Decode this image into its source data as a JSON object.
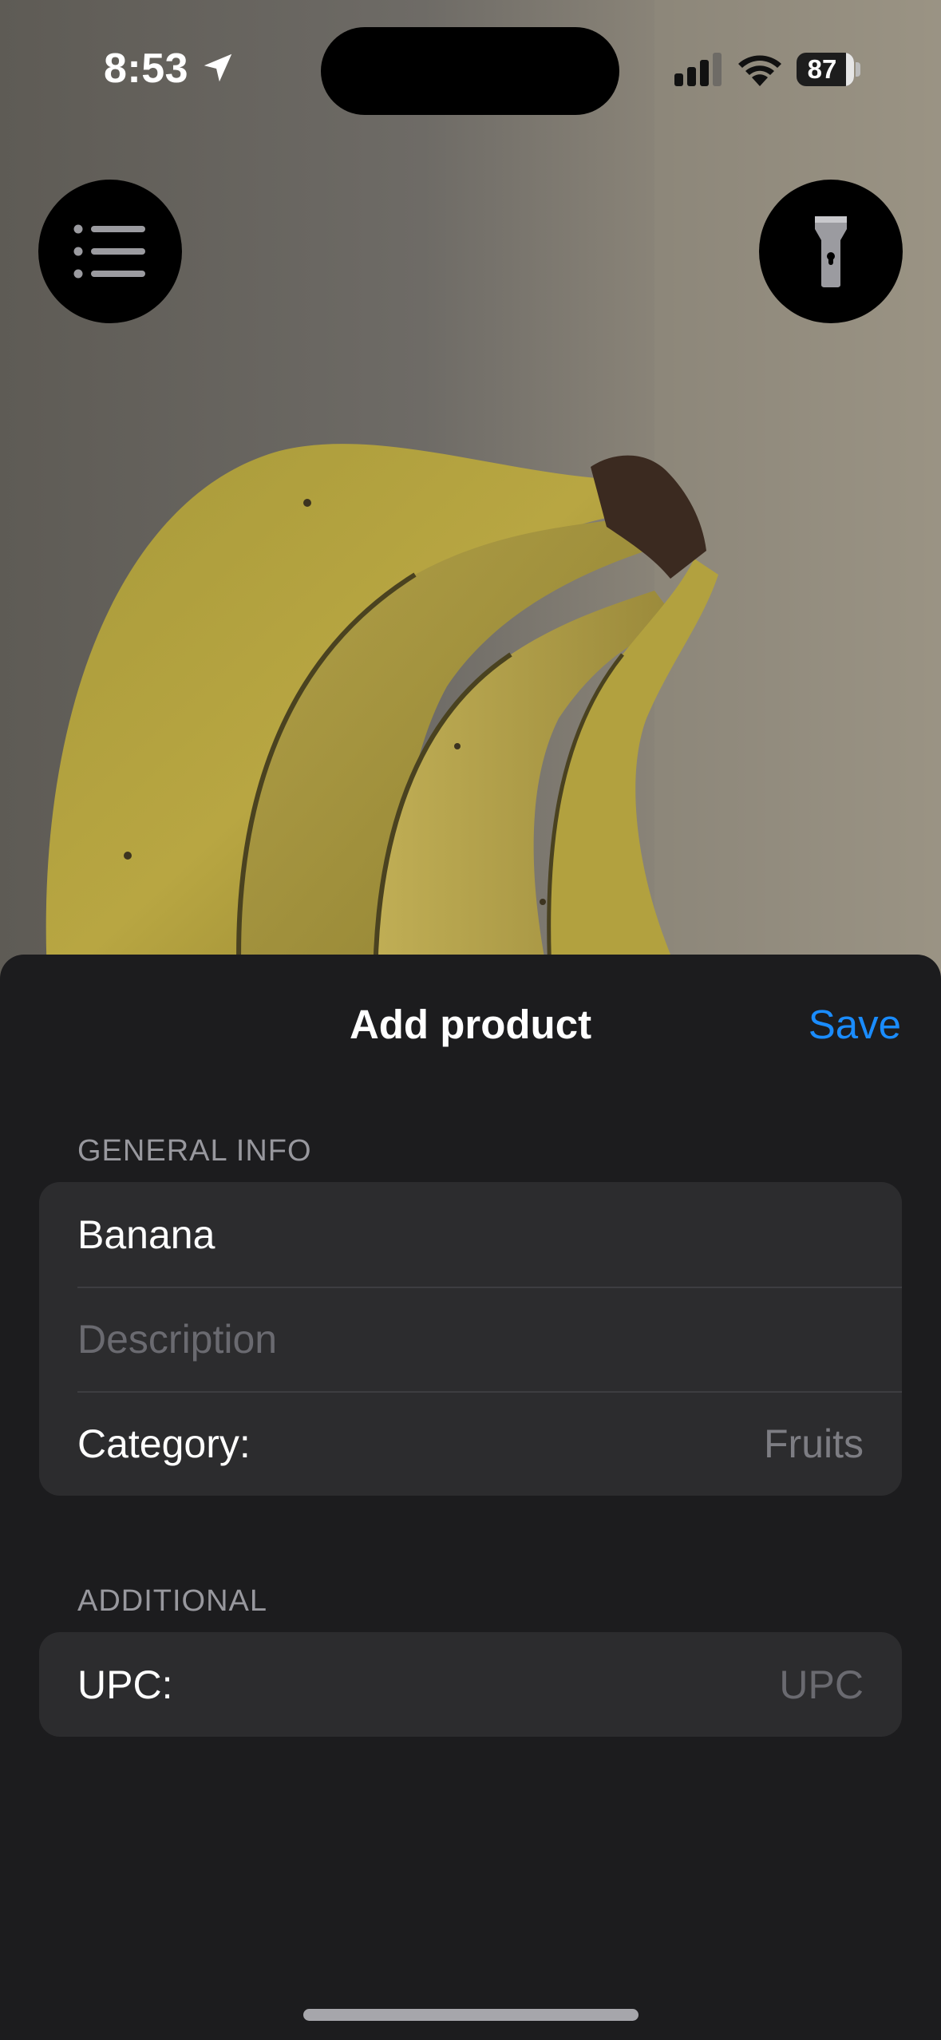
{
  "status_bar": {
    "time": "8:53",
    "battery_percent": "87",
    "battery_level": 0.87
  },
  "camera": {
    "menu_icon": "list-bullet-icon",
    "flash_icon": "flashlight-icon"
  },
  "sheet": {
    "title": "Add product",
    "save_label": "Save",
    "general_header": "GENERAL INFO",
    "name_value": "Banana",
    "description_placeholder": "Description",
    "category_label": "Category:",
    "category_value": "Fruits",
    "additional_header": "ADDITIONAL",
    "upc_label": "UPC:",
    "upc_placeholder": "UPC"
  },
  "colors": {
    "accent": "#1a8cff",
    "sheet_background": "#1c1c1e",
    "group_background": "#2c2c2e"
  }
}
